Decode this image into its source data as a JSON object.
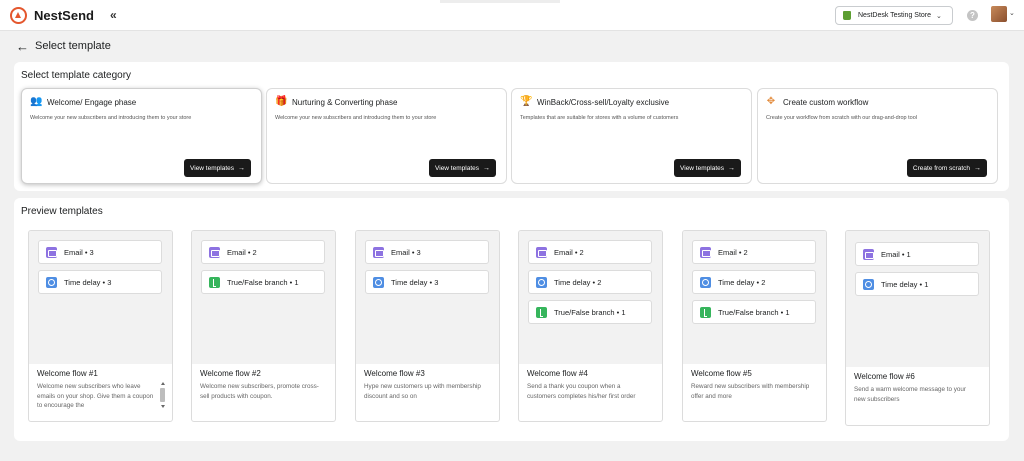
{
  "app": {
    "name": "NestSend",
    "collapse_glyph": "«"
  },
  "topbar": {
    "store_name": "NestDesk Testing Store",
    "store_chevron": "⌄",
    "help_glyph": "?",
    "avatar_chevron": "⌄"
  },
  "header": {
    "back_glyph": "←",
    "title": "Select template"
  },
  "categories": {
    "title": "Select template category",
    "items": [
      {
        "icon": "users-icon",
        "glyph": "👥",
        "title": "Welcome/ Engage phase",
        "desc": "Welcome your new subscribers and introducing them to your store",
        "button": "View templates"
      },
      {
        "icon": "gift-icon",
        "glyph": "🎁",
        "title": "Nurturing & Converting phase",
        "desc": "Welcome your new subscribers and introducing them to your store",
        "button": "View templates"
      },
      {
        "icon": "trophy-icon",
        "glyph": "🏆",
        "title": "WinBack/Cross-sell/Loyalty exclusive",
        "desc": "Templates that are suitable for stores with a volume of customers",
        "button": "View templates"
      },
      {
        "icon": "move-icon",
        "glyph": "✥",
        "title": "Create custom workflow",
        "desc": "Create your workflow from scratch with our drag-and-drop tool",
        "button": "Create from scratch"
      }
    ],
    "button_arrow": "→"
  },
  "previews": {
    "title": "Preview templates",
    "items": [
      {
        "name": "Welcome flow #1",
        "desc": "Welcome new subscribers who leave emails on your shop. Give them a coupon to encourage the",
        "chips": [
          {
            "type": "email",
            "label": "Email • 3"
          },
          {
            "type": "delay",
            "label": "Time delay • 3"
          }
        ]
      },
      {
        "name": "Welcome flow #2",
        "desc": "Welcome new subscribers, promote cross-sell products with coupon.",
        "chips": [
          {
            "type": "email",
            "label": "Email • 2"
          },
          {
            "type": "branch",
            "label": "True/False branch • 1"
          }
        ]
      },
      {
        "name": "Welcome flow #3",
        "desc": "Hype new customers up with membership discount and so on",
        "chips": [
          {
            "type": "email",
            "label": "Email • 3"
          },
          {
            "type": "delay",
            "label": "Time delay • 3"
          }
        ]
      },
      {
        "name": "Welcome flow #4",
        "desc": "Send a thank you coupon when a customers completes his/her first order",
        "chips": [
          {
            "type": "email",
            "label": "Email • 2"
          },
          {
            "type": "delay",
            "label": "Time delay • 2"
          },
          {
            "type": "branch",
            "label": "True/False branch • 1"
          }
        ]
      },
      {
        "name": "Welcome flow #5",
        "desc": "Reward new subscribers with membership offer and more",
        "chips": [
          {
            "type": "email",
            "label": "Email • 2"
          },
          {
            "type": "delay",
            "label": "Time delay • 2"
          },
          {
            "type": "branch",
            "label": "True/False branch • 1"
          }
        ]
      },
      {
        "name": "Welcome flow #6",
        "desc": "Send a warm welcome message to your new subscribers",
        "chips": [
          {
            "type": "email",
            "label": "Email • 1"
          },
          {
            "type": "delay",
            "label": "Time delay • 1"
          }
        ]
      }
    ]
  },
  "colors": {
    "accent": "#e4572e",
    "email": "#8d72e1",
    "delay": "#4f8ee3",
    "branch": "#36b55c",
    "button": "#1a1a1a"
  }
}
